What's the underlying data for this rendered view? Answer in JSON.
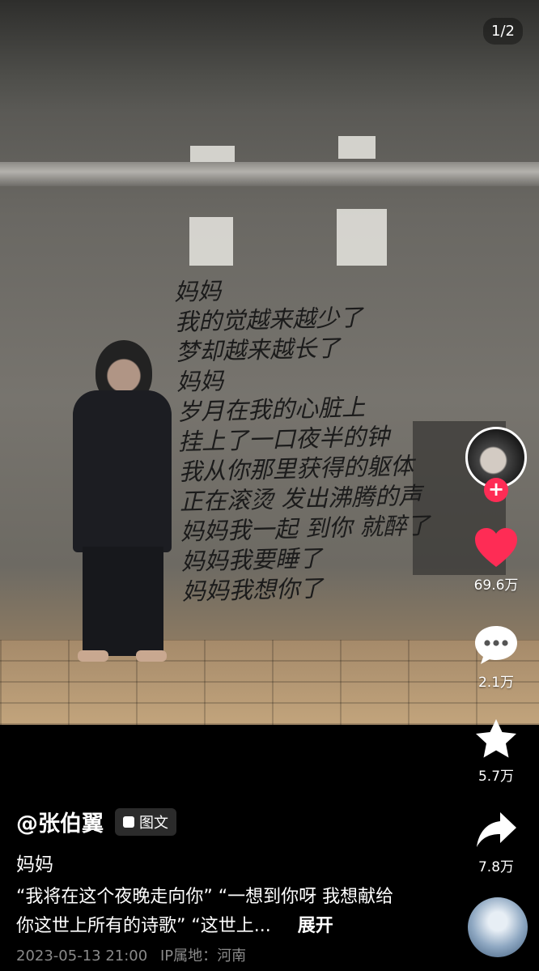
{
  "page_counter": "1/2",
  "wall_poem": [
    "妈妈",
    "我的觉越来越少了",
    "梦却越来越长了",
    "妈妈",
    "岁月在我的心脏上",
    "挂上了一口夜半的钟",
    "我从你那里获得的躯体",
    "正在滚烫 发出沸腾的声",
    "妈妈我一起 到你 就醉了",
    "妈妈我要睡了",
    "妈妈我想你了"
  ],
  "actions": {
    "like_count": "69.6万",
    "comment_count": "2.1万",
    "favorite_count": "5.7万",
    "share_count": "7.8万",
    "follow_symbol": "+"
  },
  "post": {
    "author": "@张伯翼",
    "type_badge": "图文",
    "title": "妈妈",
    "description": "“我将在这个夜晚走向你” “一想到你呀 我想献给你这世上所有的诗歌” “这世上...",
    "expand_label": "展开",
    "datetime": "2023-05-13 21:00",
    "ip_location": "IP属地：河南"
  },
  "colors": {
    "like": "#fe2c55",
    "follow": "#fe2c55",
    "meta_text": "#8a8a8a"
  },
  "icons": [
    "heart-icon",
    "comment-icon",
    "star-icon",
    "share-icon",
    "plus-icon",
    "image-text-icon"
  ]
}
